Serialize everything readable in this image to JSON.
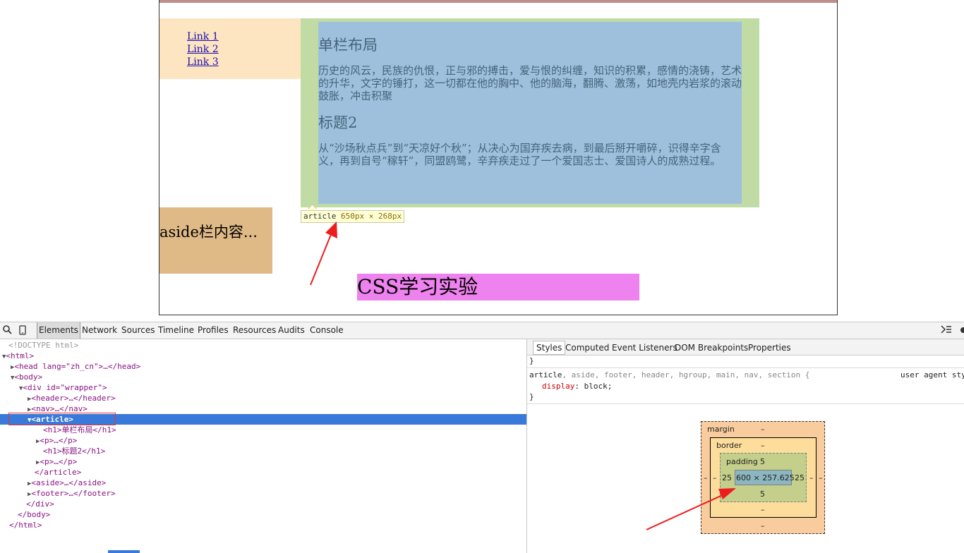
{
  "page": {
    "nav_links": [
      "Link 1",
      "Link 2",
      "Link 3"
    ],
    "article": {
      "h1": "单栏布局",
      "p1": "历史的风云，民族的仇恨，正与邪的搏击，爱与恨的纠缠，知识的积累，感情的浇铸，艺术的升华，文字的锤打，这一切都在他的胸中、他的脑海，翻腾、激荡，如地壳内岩浆的滚动鼓胀，冲击积聚",
      "h2": "标题2",
      "p2": "从“沙场秋点兵”到“天凉好个秋”；从决心为国弃疾去病，到最后掰开嚼碎，识得辛字含义，再到自号“稼轩”，同盟鸥鹭，辛弃疾走过了一个爱国志士、爱国诗人的成熟过程。"
    },
    "tooltip": {
      "tag": "article",
      "size": "650px × 268px"
    },
    "aside_text": "aside栏内容...",
    "footer_text": "CSS学习实验"
  },
  "devtools": {
    "tabs": [
      "Elements",
      "Network",
      "Sources",
      "Timeline",
      "Profiles",
      "Resources",
      "Audits",
      "Console"
    ],
    "dom_lines": [
      "<!DOCTYPE html>",
      "<html>",
      "<head lang=\"zh_cn\">…</head>",
      "<body>",
      "<div id=\"wrapper\">",
      "<header>…</header>",
      "<nav>…</nav>",
      "<article>",
      "<h1>单栏布局</h1>",
      "<p>…</p>",
      "<h1>标题2</h1>",
      "<p>…</p>",
      "</article>",
      "<aside>…</aside>",
      "<footer>…</footer>",
      "</div>",
      "</body>",
      "</html>"
    ],
    "side_tabs": [
      "Styles",
      "Computed",
      "Event Listeners",
      "DOM Breakpoints",
      "Properties"
    ],
    "css": {
      "closing_brace": "}",
      "selector_main": "article",
      "selector_rest": ", aside, footer, header, hgroup, main, nav, section {",
      "source": "user agent sty",
      "prop": "display",
      "value": "block;",
      "end": "}"
    },
    "box_model": {
      "margin_label": "margin",
      "margin_top": "–",
      "margin_bottom": "–",
      "margin_left": "–",
      "margin_right": "–",
      "border_label": "border",
      "border_top": "–",
      "border_bottom": "–",
      "border_left": "–",
      "border_right": "–",
      "padding_label": "padding",
      "padding_top": "5",
      "padding_bottom": "5",
      "padding_left": "25",
      "padding_right": "25",
      "content": "600 × 257.625"
    }
  },
  "colors": {
    "arrow": "#ee1c1c",
    "selection": "#3879d9"
  }
}
